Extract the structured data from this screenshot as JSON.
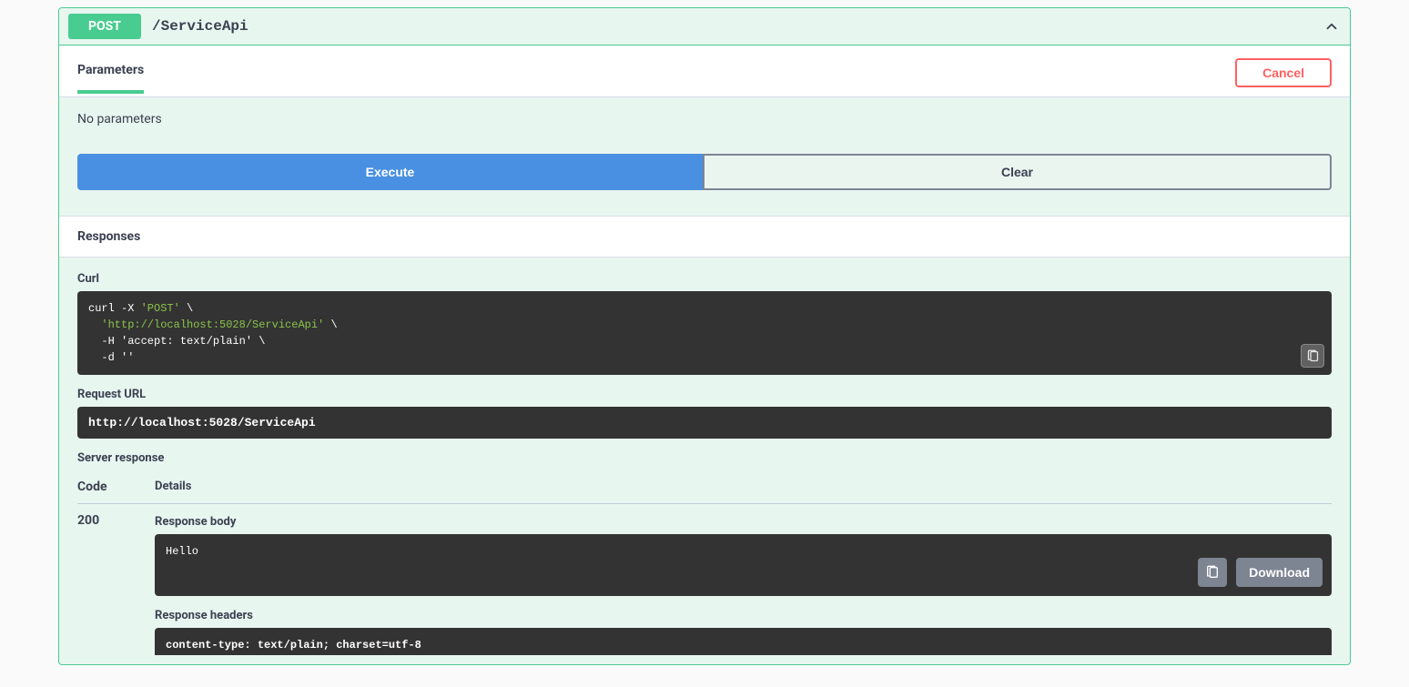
{
  "op": {
    "method": "POST",
    "path": "/ServiceApi"
  },
  "tabs": {
    "parameters": "Parameters",
    "cancel": "Cancel"
  },
  "params": {
    "none": "No parameters"
  },
  "buttons": {
    "execute": "Execute",
    "clear": "Clear",
    "download": "Download"
  },
  "responses": {
    "heading": "Responses",
    "curl_label": "Curl",
    "curl_line1_pre": "curl -X ",
    "curl_line1_method": "'POST'",
    "curl_line1_post": " \\",
    "curl_line2_url": "  'http://localhost:5028/ServiceApi'",
    "curl_line2_post": " \\",
    "curl_line3": "  -H 'accept: text/plain' \\",
    "curl_line4": "  -d ''",
    "request_url_label": "Request URL",
    "request_url": "http://localhost:5028/ServiceApi",
    "server_response_label": "Server response",
    "code_header": "Code",
    "details_header": "Details",
    "status_code": "200",
    "response_body_label": "Response body",
    "response_body": "Hello",
    "response_headers_label": "Response headers",
    "response_headers": " content-type: text/plain; charset=utf-8"
  }
}
